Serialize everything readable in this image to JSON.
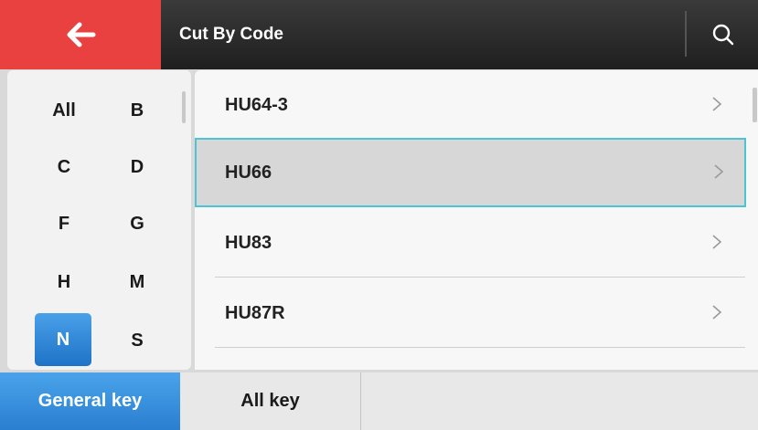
{
  "header": {
    "title": "Cut By Code",
    "back_icon": "arrow-left-icon",
    "search_icon": "search-icon",
    "accent_color": "#e8413f"
  },
  "letters": [
    "All",
    "B",
    "C",
    "D",
    "F",
    "G",
    "H",
    "M",
    "N",
    "S"
  ],
  "selected_letter": "N",
  "items": [
    {
      "label": "HU64-3"
    },
    {
      "label": "HU66"
    },
    {
      "label": "HU83"
    },
    {
      "label": "HU87R"
    }
  ],
  "selected_item": "HU66",
  "tabs": [
    {
      "label": "General key"
    },
    {
      "label": "All key"
    }
  ],
  "active_tab": "General key",
  "colors": {
    "selection_blue": "#2a7fd0",
    "selected_row_border": "#4ec3d3"
  }
}
